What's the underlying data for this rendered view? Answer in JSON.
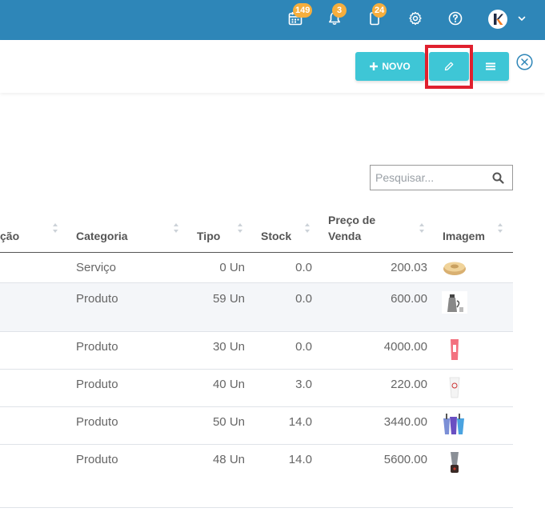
{
  "topbar": {
    "calendar_badge": "149",
    "notifications_badge": "3",
    "tasks_badge": "24",
    "avatar_letter": "K"
  },
  "toolbar": {
    "new_label": "NOVO"
  },
  "search": {
    "placeholder": "Pesquisar..."
  },
  "table": {
    "columns": [
      "ção",
      "Categoria",
      "Tipo",
      "Stock",
      "Preço de",
      "Venda",
      "Imagem"
    ],
    "rows": [
      {
        "categoria": "Serviço",
        "tipo": "0 Un",
        "stock": "0.0",
        "preco": "200.03",
        "imagem": "round-cake-thumbnail"
      },
      {
        "categoria": "Produto",
        "tipo": "59 Un",
        "stock": "0.0",
        "preco": "600.00",
        "imagem": "kettle-thumbnail"
      },
      {
        "categoria": "Produto",
        "tipo": "30 Un",
        "stock": "0.0",
        "preco": "4000.00",
        "imagem": "pink-cup-thumbnail"
      },
      {
        "categoria": "Produto",
        "tipo": "40 Un",
        "stock": "3.0",
        "preco": "220.00",
        "imagem": "white-cup-thumbnail"
      },
      {
        "categoria": "Produto",
        "tipo": "50 Un",
        "stock": "14.0",
        "preco": "3440.00",
        "imagem": "colored-cups-thumbnail"
      },
      {
        "categoria": "Produto",
        "tipo": "48 Un",
        "stock": "14.0",
        "preco": "5600.00",
        "imagem": "blender-thumbnail"
      }
    ]
  },
  "colors": {
    "topbar": "#2e86b8",
    "button": "#3ec6d6",
    "badge": "#f6ae3d",
    "highlight": "#e0202e"
  }
}
